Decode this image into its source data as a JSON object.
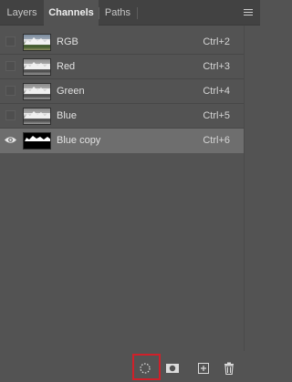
{
  "tabs": [
    {
      "label": "Layers",
      "active": false
    },
    {
      "label": "Channels",
      "active": true
    },
    {
      "label": "Paths",
      "active": false
    }
  ],
  "panel_menu_icon": "hamburger-menu-icon",
  "channels": [
    {
      "name": "RGB",
      "shortcut": "Ctrl+2",
      "visible": false,
      "selected": false,
      "thumbnail": "color-mountain"
    },
    {
      "name": "Red",
      "shortcut": "Ctrl+3",
      "visible": false,
      "selected": false,
      "thumbnail": "gray-mountain"
    },
    {
      "name": "Green",
      "shortcut": "Ctrl+4",
      "visible": false,
      "selected": false,
      "thumbnail": "gray-mountain"
    },
    {
      "name": "Blue",
      "shortcut": "Ctrl+5",
      "visible": false,
      "selected": false,
      "thumbnail": "gray-mountain"
    },
    {
      "name": "Blue copy",
      "shortcut": "Ctrl+6",
      "visible": true,
      "selected": true,
      "thumbnail": "black-mask"
    }
  ],
  "toolbar": {
    "load_selection_icon": "dotted-circle-selection-icon",
    "save_selection_icon": "mask-icon",
    "new_channel_icon": "new-channel-icon",
    "delete_icon": "trash-icon",
    "highlight_color": "#d0202a"
  },
  "colors": {
    "panel_bg": "#535353",
    "tabbar_bg": "#424242",
    "selected_row_bg": "#6e6e6e"
  }
}
